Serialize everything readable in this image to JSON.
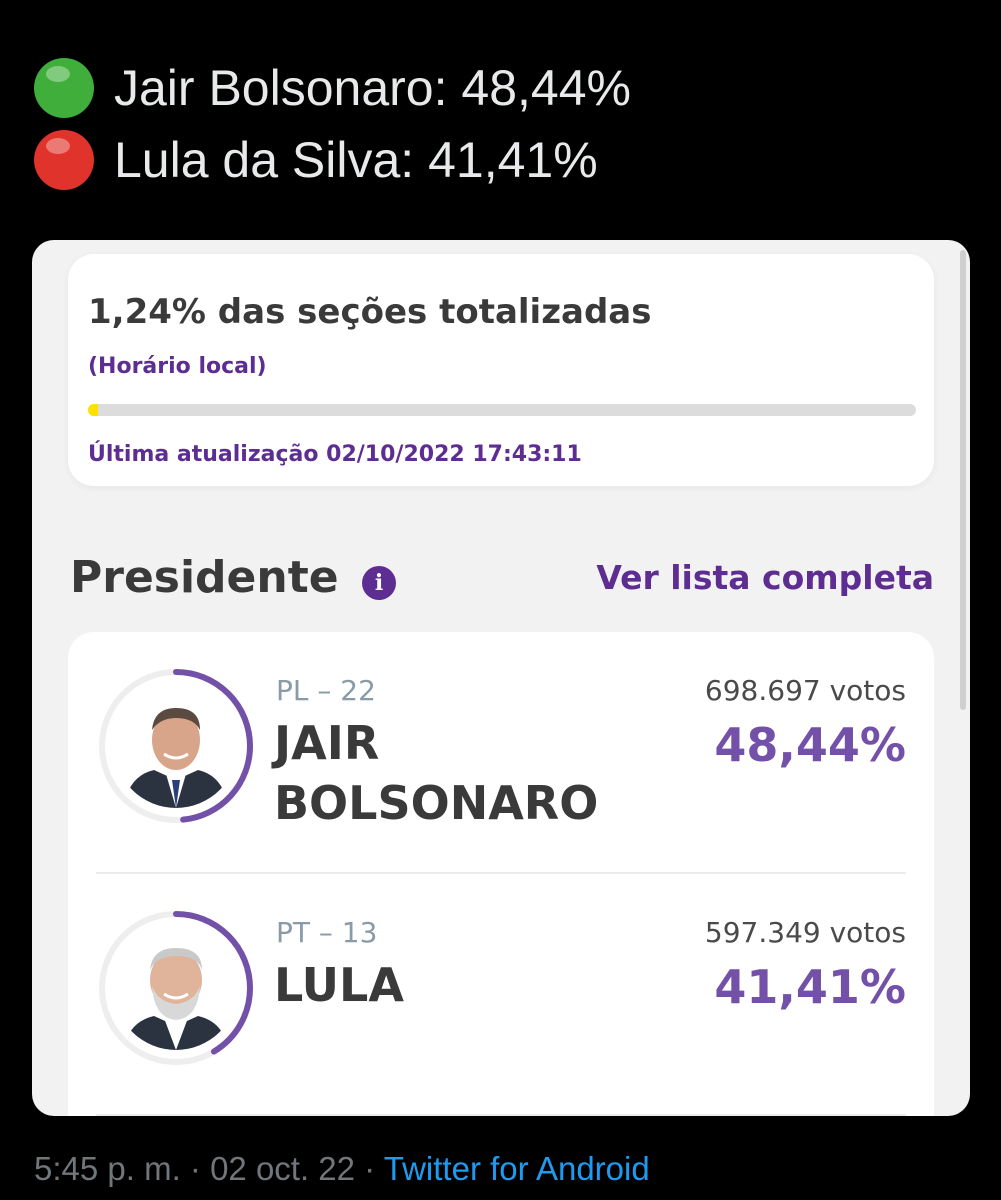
{
  "tweet": {
    "lines": [
      {
        "text": "Jair Bolsonaro: 48,44%",
        "dot_color": "#3fae3a"
      },
      {
        "text": "Lula da Silva: 41,41%",
        "dot_color": "#e0332b"
      }
    ],
    "timestamp": "5:45 p. m. · 02 oct. 22 · ",
    "source": "Twitter for Android"
  },
  "status": {
    "title": "1,24% das seções totalizadas",
    "local_time_note": "(Horário local)",
    "progress_fraction": 0.0124,
    "last_update": "Última atualização 02/10/2022 17:43:11"
  },
  "section": {
    "title": "Presidente",
    "info_icon": "info-icon",
    "see_all_label": "Ver lista completa"
  },
  "candidates": [
    {
      "party": "PL – 22",
      "name_line1": "JAIR",
      "name_line2": "BOLSONARO",
      "votes": "698.697 votos",
      "percent": "48,44%",
      "percent_value": 48.44
    },
    {
      "party": "PT – 13",
      "name_line1": "LULA",
      "name_line2": "",
      "votes": "597.349 votos",
      "percent": "41,41%",
      "percent_value": 41.41
    }
  ],
  "colors": {
    "accent_purple": "#5e2d91",
    "percent_purple": "#7351a8",
    "progress_yellow": "#ffe100",
    "twitter_blue": "#1d9bf0"
  }
}
